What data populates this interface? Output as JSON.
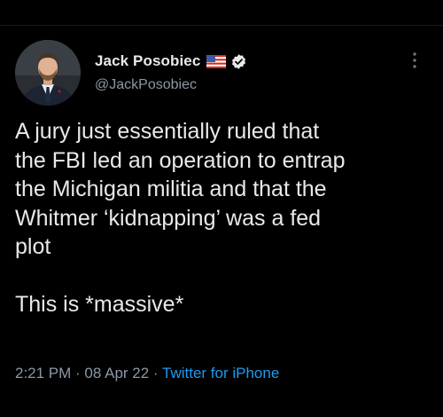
{
  "tweet": {
    "author": {
      "display_name": "Jack Posobiec",
      "handle": "@JackPosobiec",
      "flag_icon": "us-flag-icon",
      "verified_icon": "verified-badge-icon",
      "avatar": "profile-photo"
    },
    "body": "A jury just essentially ruled that\nthe FBI led an operation to entrap\nthe Michigan militia and that the\nWhitmer ‘kidnapping’ was a fed\nplot\n\nThis is *massive*",
    "time": "2:21 PM",
    "separator_1": " · ",
    "date": "08 Apr 22",
    "separator_2": " · ",
    "source": "Twitter for iPhone",
    "more_icon": "more-options-icon"
  },
  "colors": {
    "background": "#000000",
    "text": "#e7e9ea",
    "secondary": "#8b98a5",
    "link": "#1d9bf0"
  }
}
